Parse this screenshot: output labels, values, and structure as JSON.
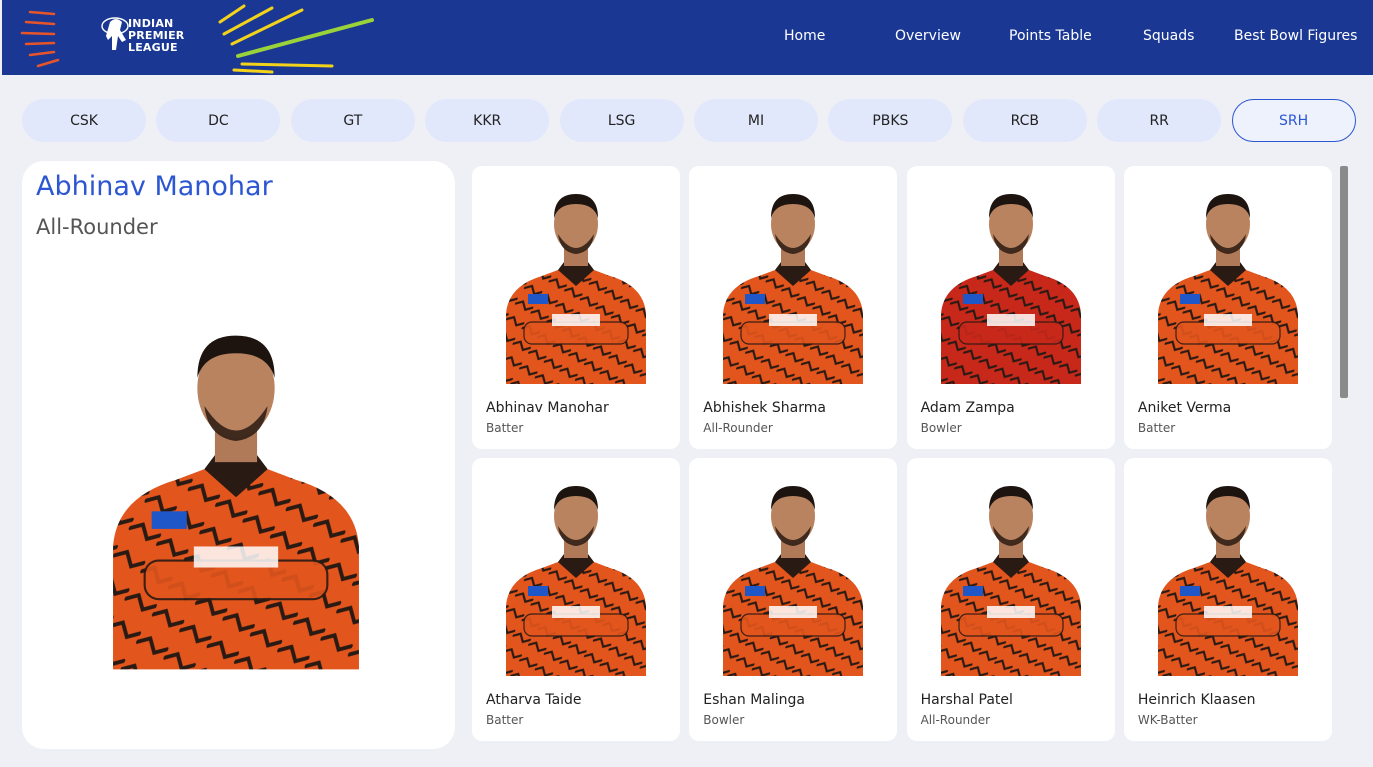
{
  "header": {
    "logo_lines": [
      "INDIAN",
      "PREMIER",
      "LEAGUE"
    ],
    "nav": [
      {
        "label": "Home",
        "active": false
      },
      {
        "label": "Overview",
        "active": false
      },
      {
        "label": "Points Table",
        "active": false
      },
      {
        "label": "Squads",
        "active": true
      },
      {
        "label": "Best Bowl Figures",
        "active": false
      }
    ]
  },
  "teams": {
    "tabs": [
      "CSK",
      "DC",
      "GT",
      "KKR",
      "LSG",
      "MI",
      "PBKS",
      "RCB",
      "RR",
      "SRH"
    ],
    "active": "SRH"
  },
  "featured": {
    "name": "Abhinav Manohar",
    "role": "All-Rounder"
  },
  "players": [
    {
      "name": "Abhinav Manohar",
      "role": "Batter",
      "kit": "orange"
    },
    {
      "name": "Abhishek Sharma",
      "role": "All-Rounder",
      "kit": "orange"
    },
    {
      "name": "Adam Zampa",
      "role": "Bowler",
      "kit": "red"
    },
    {
      "name": "Aniket Verma",
      "role": "Batter",
      "kit": "orange"
    },
    {
      "name": "Atharva Taide",
      "role": "Batter",
      "kit": "orange"
    },
    {
      "name": "Eshan Malinga",
      "role": "Bowler",
      "kit": "orange"
    },
    {
      "name": "Harshal Patel",
      "role": "All-Rounder",
      "kit": "orange"
    },
    {
      "name": "Heinrich Klaasen",
      "role": "WK-Batter",
      "kit": "orange"
    }
  ],
  "colors": {
    "header_bg": "#1a3893",
    "accent": "#2c56d2",
    "tab_bg": "#e2e8fc",
    "page_bg": "#eff0f5",
    "jersey_orange": "#e2551c",
    "jersey_red": "#c8281a"
  }
}
